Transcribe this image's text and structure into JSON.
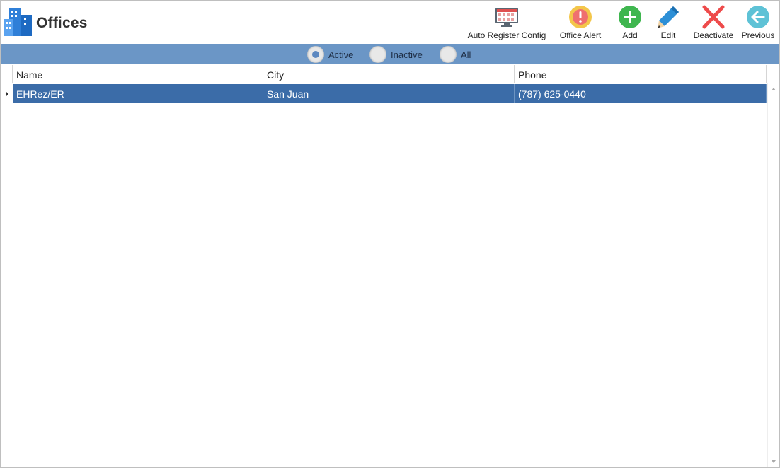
{
  "header": {
    "title": "Offices",
    "app_icon": "buildings-icon"
  },
  "toolbar": {
    "auto_register_config": {
      "label": "Auto Register Config",
      "icon": "calendar-monitor-icon"
    },
    "office_alert": {
      "label": "Office Alert",
      "icon": "alert-exclamation-icon"
    },
    "add": {
      "label": "Add",
      "icon": "plus-circle-icon"
    },
    "edit": {
      "label": "Edit",
      "icon": "pencil-icon"
    },
    "deactivate": {
      "label": "Deactivate",
      "icon": "red-x-icon"
    },
    "previous": {
      "label": "Previous",
      "icon": "arrow-left-circle-icon"
    }
  },
  "filter": {
    "options": [
      "Active",
      "Inactive",
      "All"
    ],
    "selected": "Active"
  },
  "grid": {
    "columns": [
      "Name",
      "City",
      "Phone"
    ],
    "rows": [
      {
        "name": "EHRez/ER",
        "city": "San Juan",
        "phone": "(787) 625-0440",
        "selected": true
      }
    ]
  },
  "colors": {
    "filter_bar": "#6b96c6",
    "selected_row": "#3b6ca8",
    "radio_dot": "#5c88c0"
  }
}
